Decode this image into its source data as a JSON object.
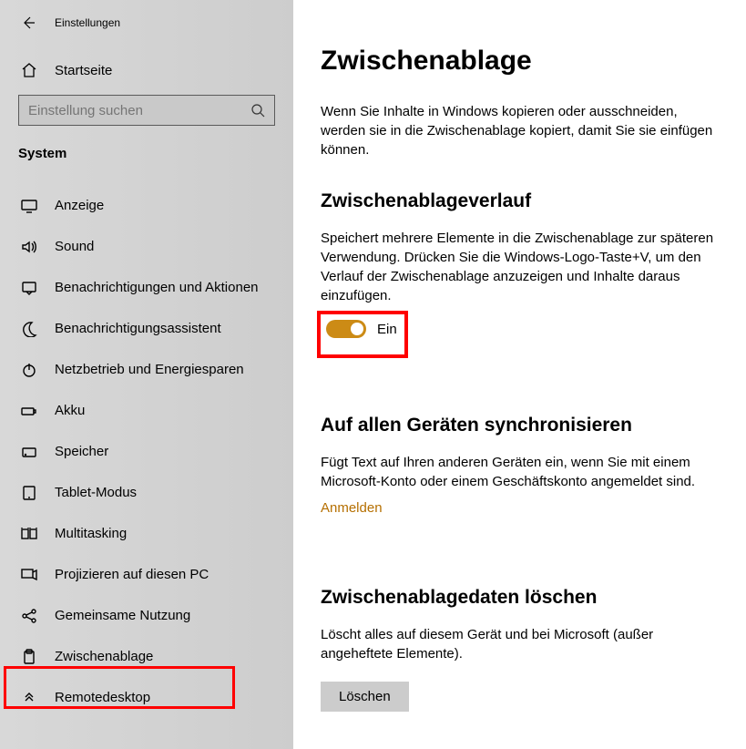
{
  "window_title": "Einstellungen",
  "home": "Startseite",
  "search_placeholder": "Einstellung suchen",
  "category": "System",
  "nav": [
    {
      "label": "Anzeige"
    },
    {
      "label": "Sound"
    },
    {
      "label": "Benachrichtigungen und Aktionen"
    },
    {
      "label": "Benachrichtigungsassistent"
    },
    {
      "label": "Netzbetrieb und Energiesparen"
    },
    {
      "label": "Akku"
    },
    {
      "label": "Speicher"
    },
    {
      "label": "Tablet-Modus"
    },
    {
      "label": "Multitasking"
    },
    {
      "label": "Projizieren auf diesen PC"
    },
    {
      "label": "Gemeinsame Nutzung"
    },
    {
      "label": "Zwischenablage"
    },
    {
      "label": "Remotedesktop"
    }
  ],
  "main": {
    "title": "Zwischenablage",
    "intro": "Wenn Sie Inhalte in Windows kopieren oder ausschneiden, werden sie in die Zwischenablage kopiert, damit Sie sie einfügen können.",
    "history_h": "Zwischenablageverlauf",
    "history_d": "Speichert mehrere Elemente in die Zwischenablage zur späteren Verwendung. Drücken Sie die Windows-Logo-Taste+V, um den Verlauf der Zwischenablage anzuzeigen und Inhalte daraus einzufügen.",
    "toggle_state": "Ein",
    "sync_h": "Auf allen Geräten synchronisieren",
    "sync_d": "Fügt Text auf Ihren anderen Geräten ein, wenn Sie mit einem Microsoft-Konto oder einem Geschäftskonto angemeldet sind.",
    "sync_link": "Anmelden",
    "clear_h": "Zwischenablagedaten löschen",
    "clear_d": "Löscht alles auf diesem Gerät und bei Microsoft (außer angeheftete Elemente).",
    "clear_btn": "Löschen"
  }
}
